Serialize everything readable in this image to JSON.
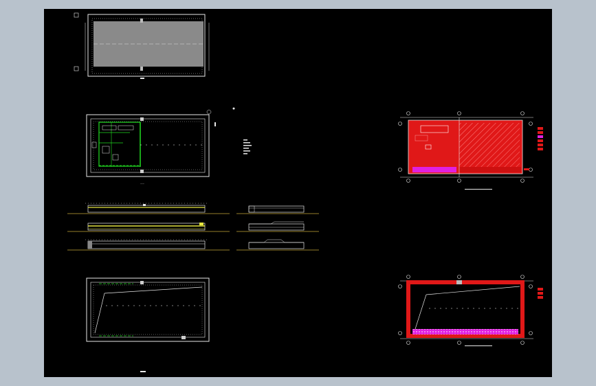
{
  "canvas": {
    "background": "#000000",
    "surround": "#b8c2cc"
  },
  "colors": {
    "line": "#e8e8e8",
    "grey_fill": "#8a8a8a",
    "green": "#22dd22",
    "yellow": "#e6e640",
    "red": "#e01818",
    "magenta": "#e020e0",
    "elevation_line": "#c8a838"
  },
  "drawings": [
    {
      "id": "roof-plan",
      "kind": "plan",
      "fill": "grey"
    },
    {
      "id": "floor-plan-1",
      "kind": "plan",
      "fill": "green-annotations"
    },
    {
      "id": "elevation-long-1",
      "kind": "elevation"
    },
    {
      "id": "elevation-long-2",
      "kind": "elevation"
    },
    {
      "id": "elevation-long-3",
      "kind": "elevation"
    },
    {
      "id": "elevation-short-1",
      "kind": "elevation"
    },
    {
      "id": "elevation-short-2",
      "kind": "elevation"
    },
    {
      "id": "elevation-short-3",
      "kind": "elevation"
    },
    {
      "id": "floor-plan-2",
      "kind": "plan",
      "fill": "diagonal"
    },
    {
      "id": "fire-zone-plan-1",
      "kind": "plan",
      "fill": "red-hatch"
    },
    {
      "id": "fire-zone-plan-2",
      "kind": "plan",
      "fill": "red-border"
    }
  ],
  "legends": {
    "center": [
      "",
      "",
      "",
      "",
      "",
      ""
    ],
    "right_top": [
      "",
      "",
      "",
      ""
    ],
    "right_bottom": [
      "",
      "",
      ""
    ]
  }
}
